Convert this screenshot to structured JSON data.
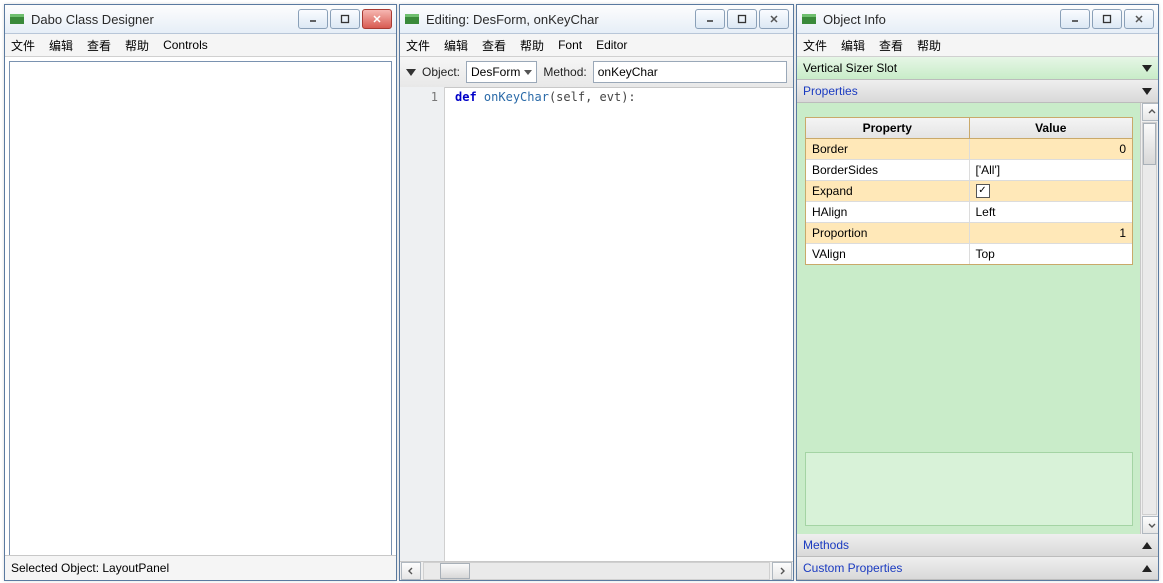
{
  "win1": {
    "title": "Dabo Class Designer",
    "menu": [
      "文件",
      "编辑",
      "查看",
      "帮助",
      "Controls"
    ],
    "status": "Selected Object: LayoutPanel"
  },
  "win2": {
    "title": "Editing: DesForm, onKeyChar",
    "menu": [
      "文件",
      "编辑",
      "查看",
      "帮助",
      "Font",
      "Editor"
    ],
    "object_label": "Object:",
    "object_value": "DesForm",
    "method_label": "Method:",
    "method_value": "onKeyChar",
    "line_no": "1",
    "kw_def": "def",
    "fn_name": "onKeyChar",
    "params": "(self, evt):"
  },
  "win3": {
    "title": "Object Info",
    "menu": [
      "文件",
      "编辑",
      "查看",
      "帮助"
    ],
    "slot_label": "Vertical Sizer Slot",
    "properties_label": "Properties",
    "methods_label": "Methods",
    "custom_label": "Custom Properties",
    "header_prop": "Property",
    "header_val": "Value",
    "rows": [
      {
        "name": "Border",
        "value": "0",
        "hl": true,
        "align": "right"
      },
      {
        "name": "BorderSides",
        "value": "['All']",
        "hl": false,
        "align": "left"
      },
      {
        "name": "Expand",
        "value": "__check__",
        "hl": true,
        "align": "left"
      },
      {
        "name": "HAlign",
        "value": "Left",
        "hl": false,
        "align": "left"
      },
      {
        "name": "Proportion",
        "value": "1",
        "hl": true,
        "align": "right"
      },
      {
        "name": "VAlign",
        "value": "Top",
        "hl": false,
        "align": "left"
      }
    ]
  }
}
